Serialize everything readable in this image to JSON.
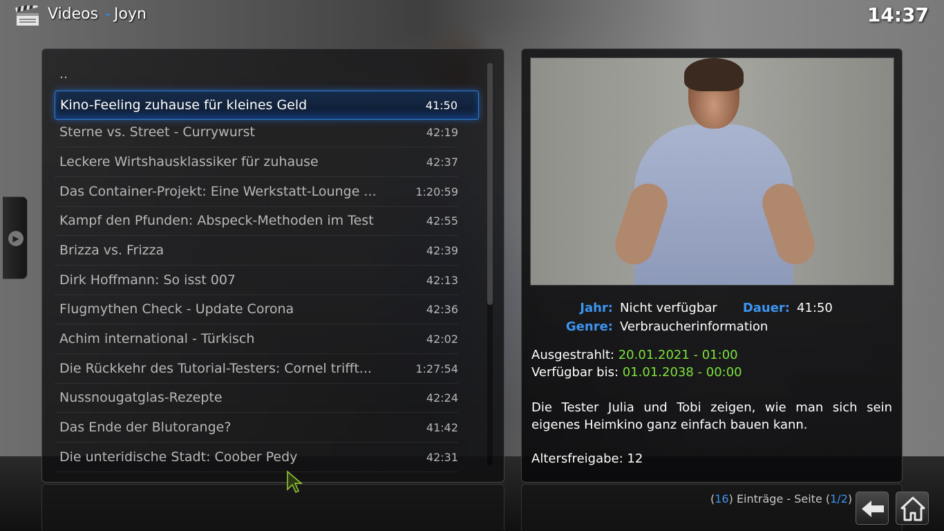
{
  "header": {
    "section": "Videos",
    "separator": "-",
    "source": "Joyn",
    "clock": "14:37"
  },
  "list": {
    "parent_label": "..",
    "items": [
      {
        "title": "Kino-Feeling zuhause für kleines Geld",
        "duration": "41:50",
        "selected": true
      },
      {
        "title": "Sterne vs. Street - Currywurst",
        "duration": "42:19"
      },
      {
        "title": "Leckere Wirtshausklassiker für zuhause",
        "duration": "42:37"
      },
      {
        "title": "Das Container-Projekt: Eine Werkstatt-Lounge ...",
        "duration": "1:20:59"
      },
      {
        "title": "Kampf den Pfunden: Abspeck-Methoden im Test",
        "duration": "42:55"
      },
      {
        "title": "Brizza vs. Frizza",
        "duration": "42:39"
      },
      {
        "title": "Dirk Hoffmann: So isst 007",
        "duration": "42:13"
      },
      {
        "title": "Flugmythen Check - Update Corona",
        "duration": "42:36"
      },
      {
        "title": "Achim international - Türkisch",
        "duration": "42:02"
      },
      {
        "title": "Die Rückkehr des Tutorial-Testers: Cornel trifft...",
        "duration": "1:27:54"
      },
      {
        "title": "Nussnougatglas-Rezepte",
        "duration": "42:24"
      },
      {
        "title": "Das Ende der Blutorange?",
        "duration": "41:42"
      },
      {
        "title": "Die unteridische Stadt: Coober Pedy",
        "duration": "42:31"
      }
    ]
  },
  "info": {
    "year_label": "Jahr:",
    "year_value": "Nicht verfügbar",
    "duration_label": "Dauer:",
    "duration_value": "41:50",
    "genre_label": "Genre:",
    "genre_value": "Verbraucherinformation",
    "aired_label": "Ausgestrahlt:",
    "aired_value": "20.01.2021 - 01:00",
    "available_label": "Verfügbar bis:",
    "available_value": "01.01.2038 - 00:00",
    "plot": "Die Tester Julia und Tobi zeigen, wie man sich sein eigenes Heimkino ganz einfach bauen kann.",
    "age_rating": "Altersfreigabe: 12"
  },
  "footer": {
    "count_open": "(",
    "count": "16",
    "entries_text": ") Einträge - Seite (",
    "page": "1/2",
    "close": ")"
  },
  "colors": {
    "accent": "#3d95f0",
    "date_green": "#7ee23a"
  },
  "icons": {
    "header": "clapperboard-icon",
    "back": "back-arrow-icon",
    "home": "home-icon",
    "side": "chevron-right-icon"
  }
}
